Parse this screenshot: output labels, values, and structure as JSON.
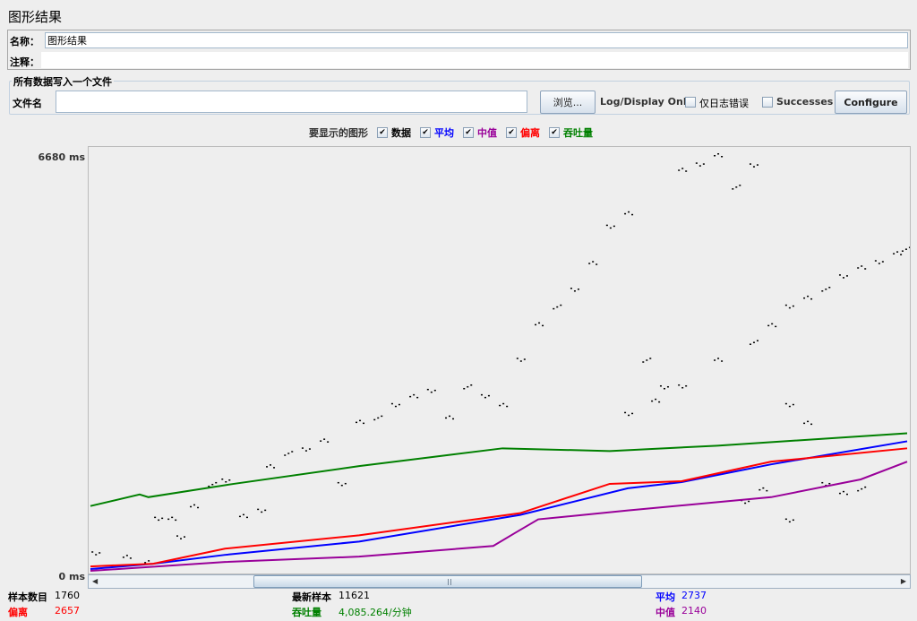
{
  "title": "图形结果",
  "name_label": "名称：",
  "name_value": "图形结果",
  "comments_label": "注释：",
  "comments_value": "",
  "file_group": {
    "legend": "所有数据写入一个文件",
    "filename_label": "文件名",
    "filename_value": "",
    "browse_label": "浏览...",
    "log_display_label": "Log/Display Only:",
    "errors_only_label": "仅日志错误",
    "errors_only_checked": false,
    "successes_label": "Successes",
    "successes_checked": false,
    "configure_label": "Configure"
  },
  "graphs": {
    "label": "要显示的图形",
    "items": [
      {
        "label": "数据",
        "checked": true,
        "color": "#000000"
      },
      {
        "label": "平均",
        "checked": true,
        "color": "#0000ff"
      },
      {
        "label": "中值",
        "checked": true,
        "color": "#990099"
      },
      {
        "label": "偏离",
        "checked": true,
        "color": "#ff0000"
      },
      {
        "label": "吞吐量",
        "checked": true,
        "color": "#008000"
      }
    ]
  },
  "chart_data": {
    "type": "line",
    "ymax_label": "6680 ms",
    "ymin_label": "0 ms",
    "ylim": [
      0,
      6680
    ],
    "xlim": [
      0,
      1760
    ],
    "series": [
      {
        "name": "吞吐量",
        "color": "#008000",
        "points": [
          [
            0,
            1065
          ],
          [
            106,
            1250
          ],
          [
            125,
            1207
          ],
          [
            309,
            1420
          ],
          [
            579,
            1704
          ],
          [
            888,
            1988
          ],
          [
            1119,
            1945
          ],
          [
            1351,
            2031
          ],
          [
            1760,
            2229
          ]
        ]
      },
      {
        "name": "平均",
        "color": "#0000ff",
        "points": [
          [
            0,
            57
          ],
          [
            135,
            142
          ],
          [
            290,
            284
          ],
          [
            579,
            497
          ],
          [
            926,
            923
          ],
          [
            1158,
            1349
          ],
          [
            1274,
            1448
          ],
          [
            1467,
            1732
          ],
          [
            1760,
            2101
          ]
        ]
      },
      {
        "name": "偏离",
        "color": "#ff0000",
        "points": [
          [
            0,
            99
          ],
          [
            135,
            142
          ],
          [
            290,
            384
          ],
          [
            579,
            596
          ],
          [
            926,
            951
          ],
          [
            1119,
            1420
          ],
          [
            1274,
            1462
          ],
          [
            1467,
            1775
          ],
          [
            1760,
            1988
          ]
        ]
      },
      {
        "name": "中值",
        "color": "#990099",
        "points": [
          [
            0,
            28
          ],
          [
            290,
            170
          ],
          [
            579,
            256
          ],
          [
            868,
            426
          ],
          [
            916,
            639
          ],
          [
            965,
            852
          ],
          [
            1158,
            994
          ],
          [
            1467,
            1207
          ],
          [
            1660,
            1491
          ],
          [
            1760,
            1775
          ]
        ]
      }
    ],
    "data_points": [
      [
        10,
        312
      ],
      [
        77,
        256
      ],
      [
        116,
        170
      ],
      [
        145,
        880
      ],
      [
        174,
        880
      ],
      [
        193,
        568
      ],
      [
        222,
        1065
      ],
      [
        261,
        1420
      ],
      [
        290,
        1491
      ],
      [
        328,
        923
      ],
      [
        367,
        994
      ],
      [
        386,
        1704
      ],
      [
        425,
        1917
      ],
      [
        463,
        1988
      ],
      [
        502,
        2130
      ],
      [
        540,
        1420
      ],
      [
        579,
        2414
      ],
      [
        618,
        2485
      ],
      [
        656,
        2698
      ],
      [
        695,
        2840
      ],
      [
        733,
        2911
      ],
      [
        772,
        2485
      ],
      [
        811,
        2982
      ],
      [
        849,
        2840
      ],
      [
        888,
        2698
      ],
      [
        926,
        3408
      ],
      [
        965,
        3976
      ],
      [
        1004,
        4260
      ],
      [
        1042,
        4544
      ],
      [
        1081,
        4970
      ],
      [
        1119,
        5538
      ],
      [
        1158,
        5751
      ],
      [
        1197,
        3408
      ],
      [
        1235,
        2982
      ],
      [
        1274,
        6461
      ],
      [
        1312,
        6532
      ],
      [
        1351,
        6680
      ],
      [
        1390,
        6177
      ],
      [
        1428,
        6532
      ],
      [
        1467,
        3976
      ],
      [
        1505,
        4260
      ],
      [
        1544,
        4402
      ],
      [
        1583,
        4544
      ],
      [
        1621,
        4757
      ],
      [
        1660,
        4899
      ],
      [
        1698,
        4970
      ],
      [
        1737,
        5112
      ],
      [
        1756,
        5183
      ],
      [
        1158,
        2556
      ],
      [
        1216,
        2769
      ],
      [
        1274,
        2982
      ],
      [
        1351,
        3408
      ],
      [
        1428,
        3692
      ],
      [
        1505,
        2698
      ],
      [
        1544,
        2414
      ],
      [
        1583,
        1420
      ],
      [
        1621,
        1278
      ],
      [
        1660,
        1349
      ],
      [
        1505,
        852
      ],
      [
        1448,
        1349
      ],
      [
        1409,
        1136
      ]
    ]
  },
  "stats": {
    "samples_label": "样本数目",
    "samples_value": "1760",
    "latest_label": "最新样本",
    "latest_value": "11621",
    "average_label": "平均",
    "average_value": "2737",
    "deviation_label": "偏离",
    "deviation_value": "2657",
    "throughput_label": "吞吐量",
    "throughput_value": "4,085.264/分钟",
    "median_label": "中值",
    "median_value": "2140"
  },
  "scrollbar": {
    "position_fraction": 0.19,
    "visible_fraction": 0.49
  }
}
